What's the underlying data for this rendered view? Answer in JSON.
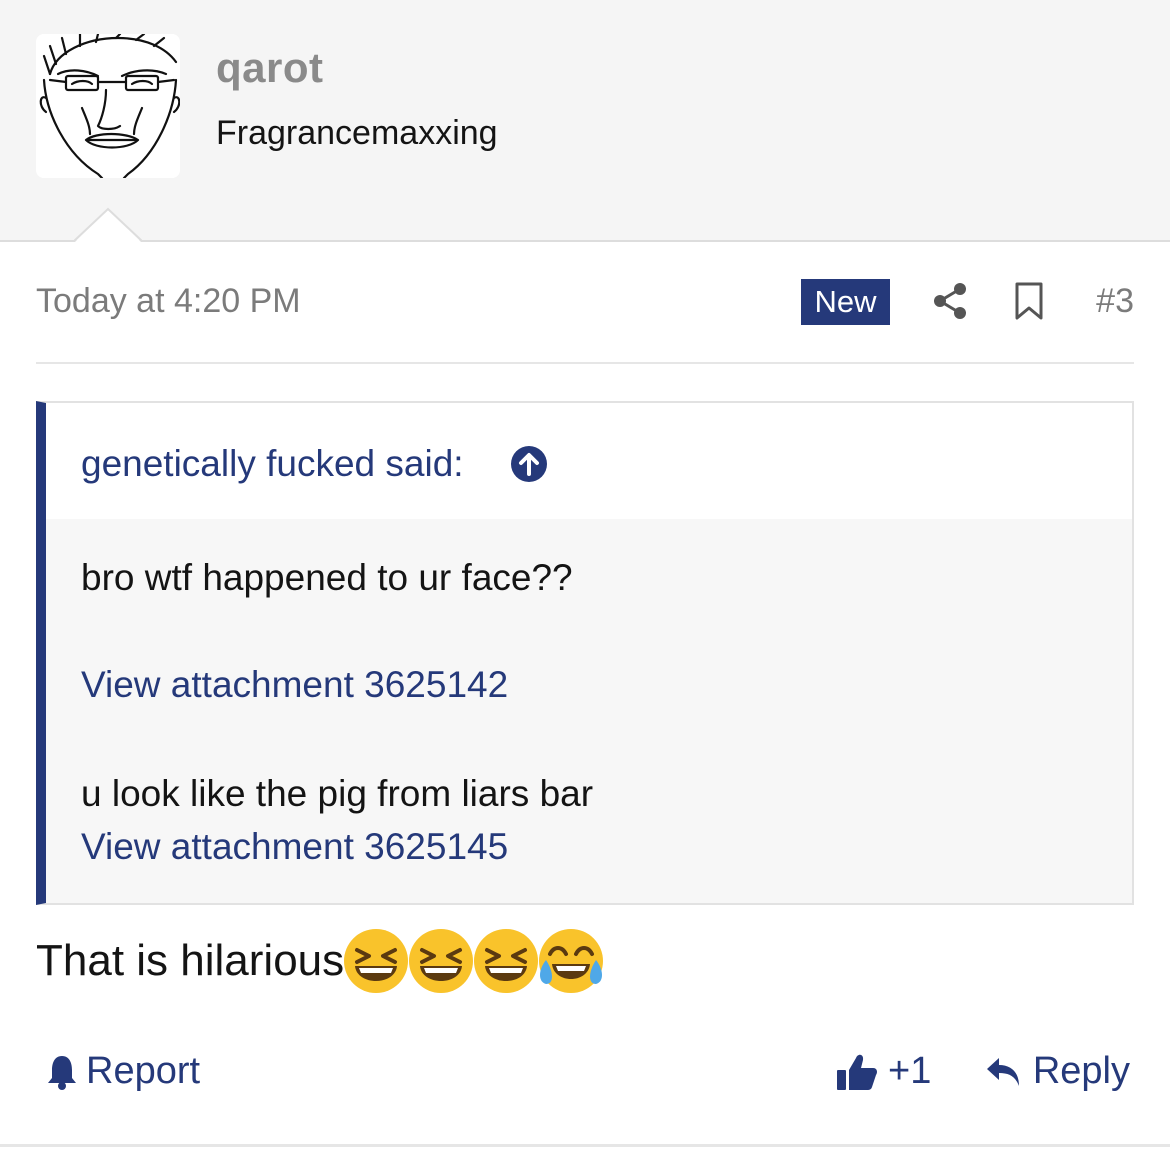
{
  "user": {
    "name": "qarot",
    "title": "Fragrancemaxxing"
  },
  "post": {
    "timestamp": "Today at 4:20 PM",
    "badge": "New",
    "number": "#3",
    "body_text": "That is hilarious",
    "emojis": [
      "grinning-squinting-face-icon",
      "grinning-squinting-face-icon",
      "grinning-squinting-face-icon",
      "face-with-tears-of-joy-icon"
    ]
  },
  "quote": {
    "attribution": "genetically fucked said:",
    "lines": [
      {
        "type": "text",
        "value": "bro wtf happened to ur face??"
      },
      {
        "type": "link",
        "value": "View attachment 3625142"
      },
      {
        "type": "text",
        "value": "u look like the pig from liars bar"
      },
      {
        "type": "link",
        "value": "View attachment 3625145"
      }
    ]
  },
  "actions": {
    "report": "Report",
    "like": "+1",
    "reply": "Reply"
  },
  "colors": {
    "accent": "#25397a",
    "header_bg": "#f5f5f5",
    "muted_text": "#7b7b7b"
  }
}
